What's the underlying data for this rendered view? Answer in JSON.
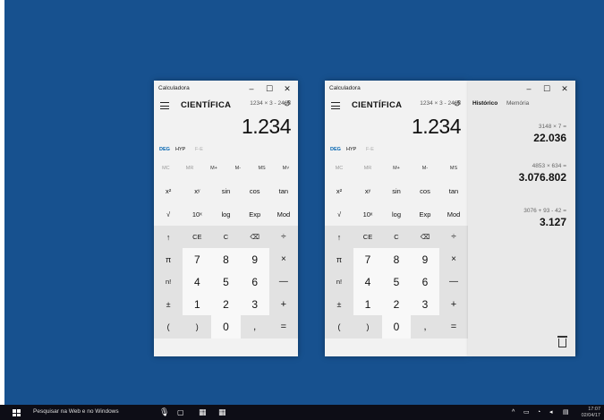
{
  "app_title": "Calculadora",
  "mode_label": "CIENTÍFICA",
  "expression": "1234 × 3 - 2468",
  "display_value": "1.234",
  "angle_modes": {
    "deg": "DEG",
    "hyp": "HYP",
    "fe": "F-E"
  },
  "memory_buttons": [
    "MC",
    "MR",
    "M+",
    "M-",
    "MS",
    "M˅"
  ],
  "keys": {
    "row1": [
      "x²",
      "xʸ",
      "sin",
      "cos",
      "tan"
    ],
    "row2": [
      "√",
      "10ˣ",
      "log",
      "Exp",
      "Mod"
    ],
    "row3": [
      "↑",
      "CE",
      "C",
      "⌫",
      "÷"
    ],
    "row4": [
      "π",
      "7",
      "8",
      "9",
      "×"
    ],
    "row5": [
      "n!",
      "4",
      "5",
      "6",
      "—"
    ],
    "row6": [
      "±",
      "1",
      "2",
      "3",
      "+"
    ],
    "row7": [
      "(",
      ")",
      "0",
      ",",
      "="
    ]
  },
  "history_panel": {
    "tabs": [
      "Histórico",
      "Memória"
    ],
    "entries": [
      {
        "expr": "3148 × 7 =",
        "result": "22.036"
      },
      {
        "expr": "4853 × 634 =",
        "result": "3.076.802"
      },
      {
        "expr": "3076 + 93 - 42 =",
        "result": "3.127"
      }
    ]
  },
  "taskbar": {
    "search_text": "Pesquisar na Web e no Windows",
    "time": "17:07",
    "date": "02/04/17"
  },
  "window_controls": {
    "minimize": "–",
    "maximize": "☐",
    "close": "✕"
  },
  "colors": {
    "desktop": "#17518f",
    "accent": "#0063b1",
    "taskbar": "#0d0d16"
  }
}
